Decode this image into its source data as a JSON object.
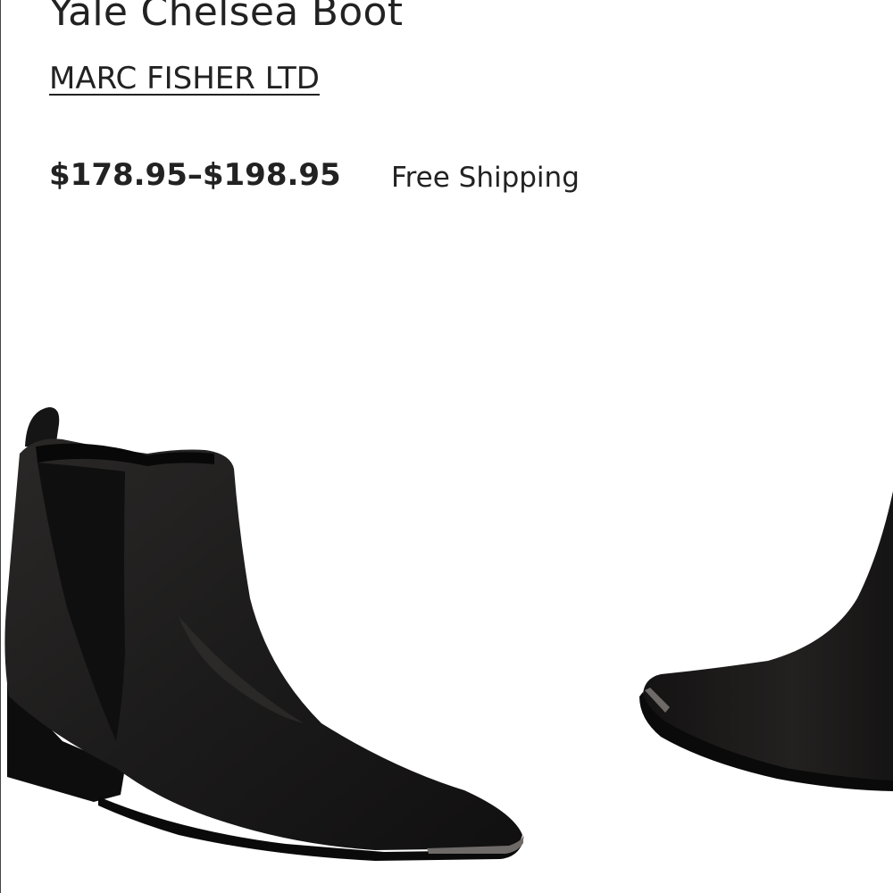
{
  "product": {
    "title": "Yale Chelsea Boot",
    "brand": "MARC FISHER LTD",
    "price": "$178.95–$198.95",
    "shipping": "Free Shipping"
  },
  "gallery": {
    "image_icon": "boot-photo",
    "colors": {
      "leather": "#1c1b1b",
      "sole": "#0d0d0d",
      "toe_cap": "#6e6a68"
    }
  }
}
